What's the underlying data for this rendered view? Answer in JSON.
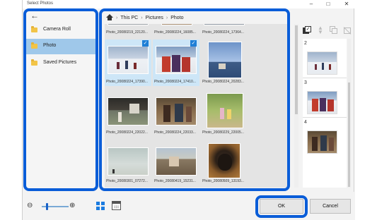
{
  "window": {
    "title": "Select Photos"
  },
  "sidebar": {
    "back_icon": "arrow-left-icon",
    "items": [
      {
        "label": "Camera Roll",
        "selected": false
      },
      {
        "label": "Photo",
        "selected": true
      },
      {
        "label": "Saved Pictures",
        "selected": false
      }
    ]
  },
  "breadcrumb": {
    "items": [
      "This PC",
      "Pictures",
      "Photo"
    ]
  },
  "photos": [
    {
      "caption": "Photo_20080219_22120...",
      "checked": false
    },
    {
      "caption": "Photo_20080224_16085...",
      "checked": false
    },
    {
      "caption": "Photo_20080224_17364...",
      "checked": false
    },
    {
      "caption": "Photo_20080224_17390...",
      "checked": true
    },
    {
      "caption": "Photo_20080224_17410...",
      "checked": true
    },
    {
      "caption": "Photo_20080224_20283...",
      "checked": false
    },
    {
      "caption": "Photo_20080224_22022...",
      "checked": false
    },
    {
      "caption": "Photo_20080224_22033...",
      "checked": false
    },
    {
      "caption": "Photo_20080229_22005...",
      "checked": false
    },
    {
      "caption": "Photo_20080301_07272...",
      "checked": false
    },
    {
      "caption": "Photo_20080419_15231...",
      "checked": false
    },
    {
      "caption": "Photo_20080509_13193...",
      "checked": false
    }
  ],
  "order": {
    "items": [
      "2",
      "3",
      "4"
    ]
  },
  "buttons": {
    "ok": "OK",
    "cancel": "Cancel"
  },
  "colors": {
    "highlight": "#0a5dd8",
    "selected_nav": "#9fc8ea",
    "check": "#1e7fd6"
  }
}
